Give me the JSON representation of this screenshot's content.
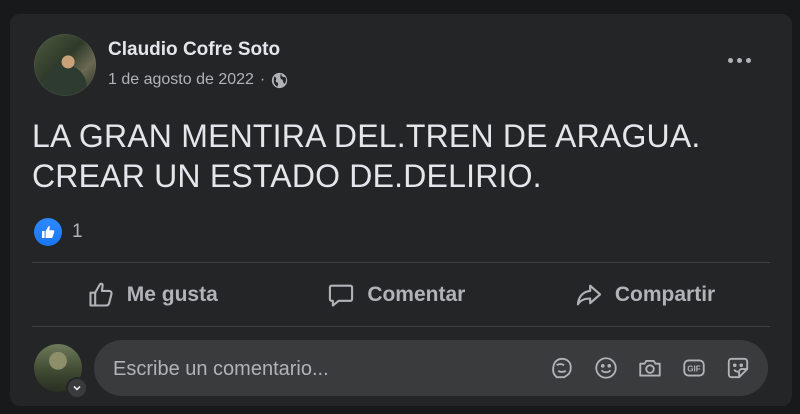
{
  "post": {
    "author": "Claudio Cofre Soto",
    "date": "1 de agosto de 2022",
    "separator": "·",
    "privacy_icon": "globe-icon",
    "text_line1": "LA GRAN MENTIRA DEL.TREN DE ARAGUA.",
    "text_line2": "CREAR UN ESTADO DE.DELIRIO.",
    "reaction_icon": "like-icon",
    "reaction_count": "1"
  },
  "actions": {
    "like_label": "Me gusta",
    "comment_label": "Comentar",
    "share_label": "Compartir"
  },
  "comment": {
    "placeholder": "Escribe un comentario...",
    "tools": [
      "avatar-sticker-icon",
      "emoji-icon",
      "camera-icon",
      "gif-icon",
      "sticker-icon"
    ]
  },
  "colors": {
    "background": "#18191a",
    "card": "#242526",
    "input": "#3a3b3c",
    "primary_text": "#e4e6eb",
    "secondary_text": "#b0b3b8",
    "like_blue": "#1877f2"
  }
}
